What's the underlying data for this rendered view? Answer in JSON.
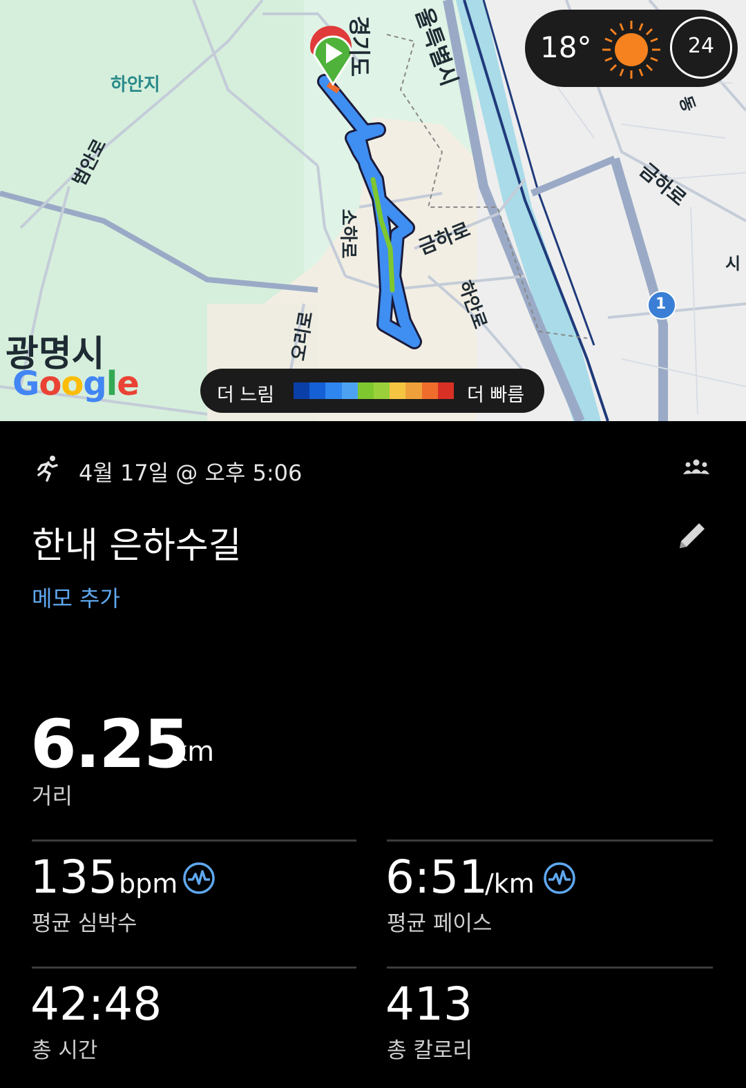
{
  "map": {
    "labels": {
      "haanji": "하안지",
      "beoman": "범안로",
      "gyeonggi": "경기도",
      "seoul": "울특별시",
      "soha": "소하로",
      "geumha1": "금하로",
      "geumha2": "금하로",
      "haan": "하안로",
      "ori": "오리로",
      "dong": "동",
      "si": "시",
      "city": "광명시"
    },
    "route_badge": "1",
    "google": [
      "G",
      "o",
      "o",
      "g",
      "l",
      "e"
    ],
    "google_colors": [
      "#4285F4",
      "#EA4335",
      "#FBBC05",
      "#4285F4",
      "#34A853",
      "#EA4335"
    ]
  },
  "weather": {
    "temperature": "18°",
    "wind_value": "24",
    "sun_color": "#F5821F"
  },
  "speed_legend": {
    "slow_label": "더 느림",
    "fast_label": "더 빠름",
    "colors": [
      "#0b3fa8",
      "#1560d4",
      "#2f86ee",
      "#4da3f2",
      "#7ec72f",
      "#9ad13a",
      "#f5c542",
      "#f0a03a",
      "#ee6d2d",
      "#d93025"
    ]
  },
  "workout": {
    "activity_icon": "running-icon",
    "datetime": "4월 17일 @ 오후 5:06",
    "title": "한내 은하수길",
    "memo_link": "메모 추가",
    "distance": {
      "value": "6.25",
      "unit": "km",
      "label": "거리"
    },
    "heart_rate": {
      "value": "135",
      "unit": "bpm",
      "label": "평균 심박수"
    },
    "pace": {
      "value": "6:51",
      "unit": "/km",
      "label": "평균 페이스"
    },
    "duration": {
      "value": "42:48",
      "label": "총 시간"
    },
    "calories": {
      "value": "413",
      "label": "총 칼로리"
    }
  },
  "colors": {
    "accent": "#5fa8f0",
    "background": "#000000"
  }
}
